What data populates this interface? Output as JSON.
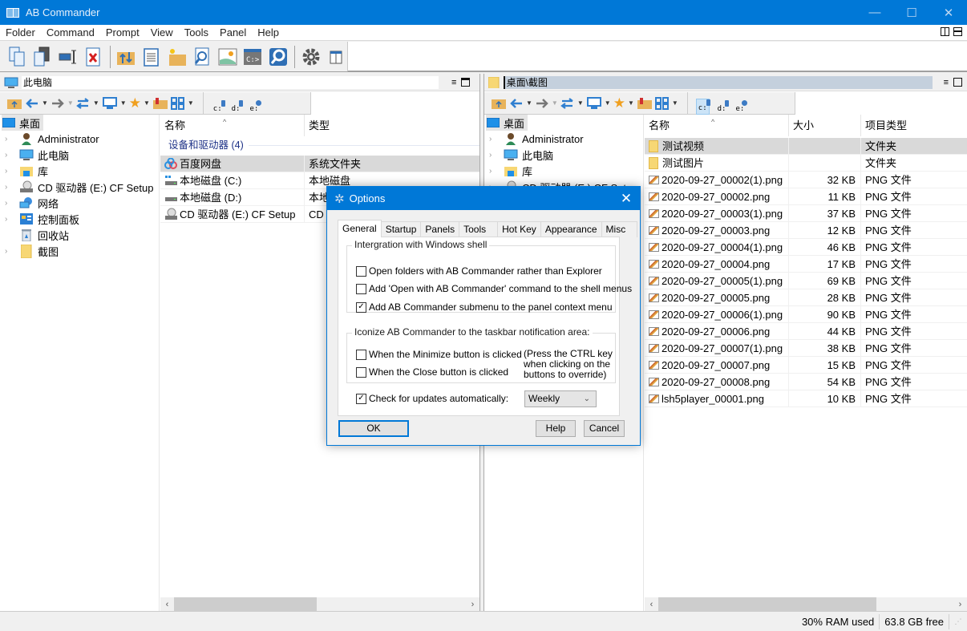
{
  "window": {
    "title": "AB Commander",
    "controls": {
      "minimize": "—",
      "maximize": "☐",
      "close": "✕"
    }
  },
  "menu": [
    "Folder",
    "Command",
    "Prompt",
    "View",
    "Tools",
    "Panel",
    "Help"
  ],
  "toolbar": {
    "buttons": [
      {
        "name": "copy-icon"
      },
      {
        "name": "move-icon"
      },
      {
        "name": "rename-icon"
      },
      {
        "name": "delete-icon"
      },
      {
        "name": "sync-folders-icon"
      },
      {
        "name": "notepad-icon"
      },
      {
        "name": "new-folder-icon"
      },
      {
        "name": "find-icon"
      },
      {
        "name": "image-viewer-icon"
      },
      {
        "name": "command-prompt-icon"
      },
      {
        "name": "disk-usage-icon"
      },
      {
        "name": "settings-icon"
      },
      {
        "name": "panel-layout-icon"
      }
    ]
  },
  "left_panel": {
    "address": "此电脑",
    "drives": [
      "c:",
      "d:",
      "e:"
    ],
    "tree": [
      {
        "label": "桌面",
        "icon": "desktop-icon",
        "root": true
      },
      {
        "label": "Administrator",
        "icon": "user-icon"
      },
      {
        "label": "此电脑",
        "icon": "computer-icon"
      },
      {
        "label": "库",
        "icon": "library-icon"
      },
      {
        "label": "CD 驱动器 (E:) CF Setup",
        "icon": "cd-drive-icon"
      },
      {
        "label": "网络",
        "icon": "network-icon"
      },
      {
        "label": "控制面板",
        "icon": "control-panel-icon"
      },
      {
        "label": "回收站",
        "icon": "recycle-bin-icon",
        "noexpand": true
      },
      {
        "label": "截图",
        "icon": "folder-icon"
      }
    ],
    "columns": [
      "名称",
      "类型"
    ],
    "group": "设备和驱动器 (4)",
    "rows": [
      {
        "name": "百度网盘",
        "type": "系统文件夹",
        "selected": true
      },
      {
        "name": "本地磁盘 (C:)",
        "type": "本地磁盘"
      },
      {
        "name": "本地磁盘 (D:)",
        "type": "本地磁盘"
      },
      {
        "name": "CD 驱动器 (E:) CF Setup",
        "type": "CD"
      }
    ]
  },
  "right_panel": {
    "address": "桌面\\截图",
    "drives": [
      "c:",
      "d:",
      "e:"
    ],
    "tree": [
      {
        "label": "桌面",
        "root": true
      },
      {
        "label": "Administrator"
      },
      {
        "label": "此电脑"
      },
      {
        "label": "库"
      },
      {
        "label": "CD 驱动器 (E:) CF Setup"
      }
    ],
    "columns": [
      "名称",
      "大小",
      "项目类型"
    ],
    "rows": [
      {
        "name": "测试视频",
        "size": "",
        "type": "文件夹",
        "folder": true,
        "selected": true
      },
      {
        "name": "测试图片",
        "size": "",
        "type": "文件夹",
        "folder": true
      },
      {
        "name": "2020-09-27_00002(1).png",
        "size": "32 KB",
        "type": "PNG 文件"
      },
      {
        "name": "2020-09-27_00002.png",
        "size": "11 KB",
        "type": "PNG 文件"
      },
      {
        "name": "2020-09-27_00003(1).png",
        "size": "37 KB",
        "type": "PNG 文件"
      },
      {
        "name": "2020-09-27_00003.png",
        "size": "12 KB",
        "type": "PNG 文件"
      },
      {
        "name": "2020-09-27_00004(1).png",
        "size": "46 KB",
        "type": "PNG 文件"
      },
      {
        "name": "2020-09-27_00004.png",
        "size": "17 KB",
        "type": "PNG 文件"
      },
      {
        "name": "2020-09-27_00005(1).png",
        "size": "69 KB",
        "type": "PNG 文件"
      },
      {
        "name": "2020-09-27_00005.png",
        "size": "28 KB",
        "type": "PNG 文件"
      },
      {
        "name": "2020-09-27_00006(1).png",
        "size": "90 KB",
        "type": "PNG 文件"
      },
      {
        "name": "2020-09-27_00006.png",
        "size": "44 KB",
        "type": "PNG 文件"
      },
      {
        "name": "2020-09-27_00007(1).png",
        "size": "38 KB",
        "type": "PNG 文件"
      },
      {
        "name": "2020-09-27_00007.png",
        "size": "15 KB",
        "type": "PNG 文件"
      },
      {
        "name": "2020-09-27_00008.png",
        "size": "54 KB",
        "type": "PNG 文件"
      },
      {
        "name": "lsh5player_00001.png",
        "size": "10 KB",
        "type": "PNG 文件"
      }
    ]
  },
  "status": {
    "ram": "30% RAM used",
    "free": "63.8 GB free"
  },
  "dialog": {
    "title": "Options",
    "tabs": [
      "General",
      "Startup",
      "Panels",
      "Tools",
      "Hot Key",
      "Appearance",
      "Misc"
    ],
    "active_tab": "General",
    "group1": {
      "legend": "Intergration with Windows shell",
      "options": [
        {
          "label": "Open folders with AB Commander rather than Explorer",
          "checked": false
        },
        {
          "label": "Add 'Open with AB Commander' command to the shell menus",
          "checked": false
        },
        {
          "label": "Add AB Commander submenu to the panel context menu",
          "checked": true
        }
      ]
    },
    "group2": {
      "legend": "Iconize AB Commander to the taskbar notification area:",
      "options": [
        {
          "label": "When the Minimize button is clicked",
          "checked": false
        },
        {
          "label": "When the Close button is clicked",
          "checked": false
        }
      ],
      "note": [
        "(Press the CTRL key",
        "when clicking on the",
        "buttons to override)"
      ]
    },
    "updates": {
      "label": "Check for updates automatically:",
      "checked": true,
      "frequency": "Weekly"
    },
    "buttons": {
      "ok": "OK",
      "help": "Help",
      "cancel": "Cancel"
    }
  },
  "colors": {
    "titlebar": "#0078d7",
    "selection": "#d9d9d9",
    "group_header": "#1e3287"
  }
}
